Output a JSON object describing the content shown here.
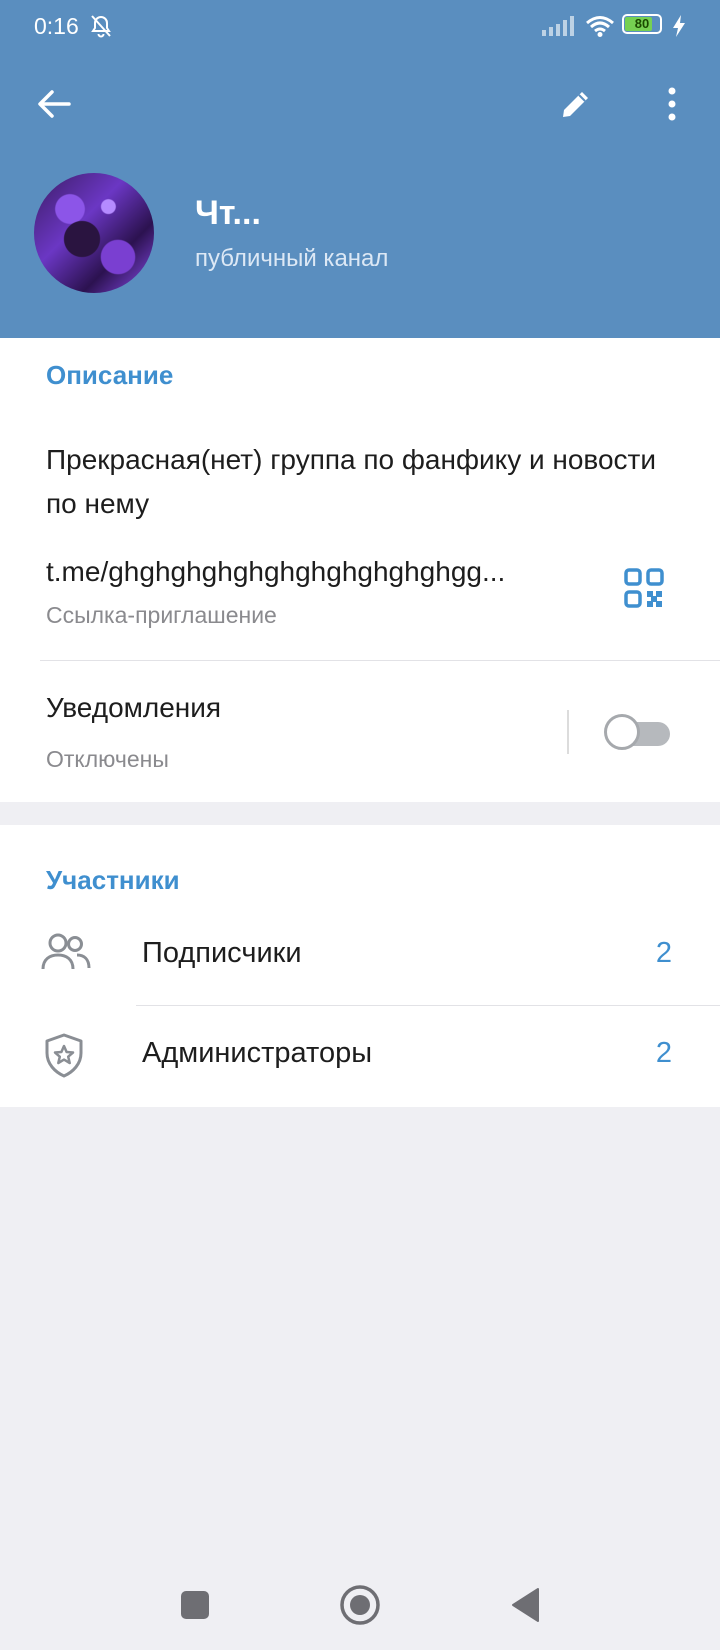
{
  "status_bar": {
    "time": "0:16",
    "battery": "80",
    "battery_level": 0.8
  },
  "header": {
    "back_icon": "arrow-left-icon",
    "edit_icon": "pencil-icon",
    "more_icon": "more-vertical-icon",
    "channel_title": "Чт...",
    "channel_subtitle": "публичный канал"
  },
  "info": {
    "description_title": "Описание",
    "description_text": "Прекрасная(нет) группа по фанфику и новости по нему",
    "link_text": "t.me/ghghghghghghghghghghghgg...",
    "link_label": "Ссылка-приглашение",
    "notifications_title": "Уведомления",
    "notifications_state": "Отключены",
    "notifications_on": false
  },
  "members": {
    "section_title": "Участники",
    "rows": [
      {
        "label": "Подписчики",
        "count": "2",
        "icon": "people-icon"
      },
      {
        "label": "Администраторы",
        "count": "2",
        "icon": "shield-star-icon"
      }
    ]
  },
  "nav": {
    "recents_icon": "square-icon",
    "home_icon": "circle-icon",
    "back_icon": "triangle-back-icon"
  },
  "colors": {
    "header_bg": "#5a8ebf",
    "accent": "#3f8fcf",
    "page_bg": "#efeff3"
  }
}
